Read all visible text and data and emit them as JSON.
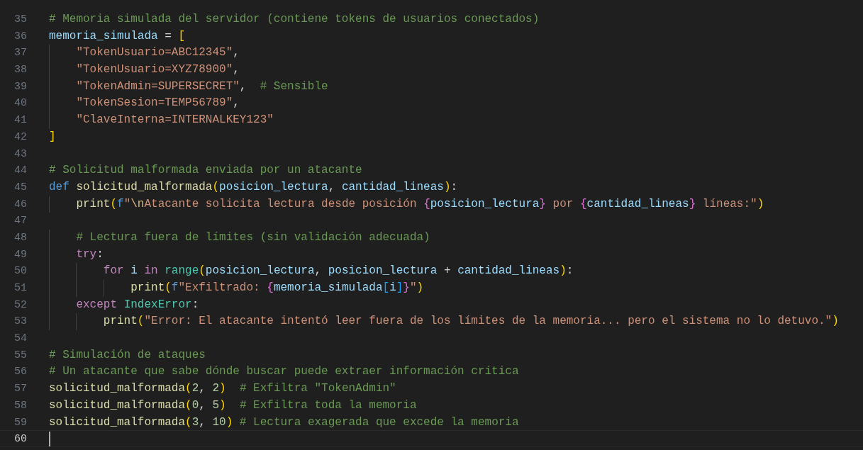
{
  "editor": {
    "lines": [
      {
        "number": "35",
        "current": false,
        "tokens": [
          {
            "kind": "comment",
            "text": "# Memoria simulada del servidor (contiene tokens de usuarios conectados)"
          }
        ]
      },
      {
        "number": "36",
        "current": false,
        "tokens": [
          {
            "kind": "variable",
            "text": "memoria_simulada"
          },
          {
            "kind": "plain",
            "text": " = "
          },
          {
            "kind": "bracket1",
            "text": "["
          }
        ]
      },
      {
        "number": "37",
        "current": false,
        "tokens": [
          {
            "kind": "string",
            "text": "    \"TokenUsuario=ABC12345\""
          },
          {
            "kind": "plain",
            "text": ","
          }
        ]
      },
      {
        "number": "38",
        "current": false,
        "tokens": [
          {
            "kind": "string",
            "text": "    \"TokenUsuario=XYZ78900\""
          },
          {
            "kind": "plain",
            "text": ","
          }
        ]
      },
      {
        "number": "39",
        "current": false,
        "tokens": [
          {
            "kind": "string",
            "text": "    \"TokenAdmin=SUPERSECRET\""
          },
          {
            "kind": "plain",
            "text": ",  "
          },
          {
            "kind": "comment",
            "text": "# Sensible"
          }
        ]
      },
      {
        "number": "40",
        "current": false,
        "tokens": [
          {
            "kind": "string",
            "text": "    \"TokenSesion=TEMP56789\""
          },
          {
            "kind": "plain",
            "text": ","
          }
        ]
      },
      {
        "number": "41",
        "current": false,
        "tokens": [
          {
            "kind": "string",
            "text": "    \"ClaveInterna=INTERNALKEY123\""
          }
        ]
      },
      {
        "number": "42",
        "current": false,
        "tokens": [
          {
            "kind": "bracket1",
            "text": "]"
          }
        ]
      },
      {
        "number": "43",
        "current": false
      },
      {
        "number": "44",
        "current": false,
        "tokens": [
          {
            "kind": "comment",
            "text": "# Solicitud malformada enviada por un atacante"
          }
        ]
      },
      {
        "number": "45",
        "current": false,
        "tokens": [
          {
            "kind": "keyword",
            "text": "def "
          },
          {
            "kind": "function",
            "text": "solicitud_malformada"
          },
          {
            "kind": "bracket1",
            "text": "("
          },
          {
            "kind": "variable",
            "text": "posicion_lectura"
          },
          {
            "kind": "plain",
            "text": ", "
          },
          {
            "kind": "variable",
            "text": "cantidad_lineas"
          },
          {
            "kind": "bracket1",
            "text": ")"
          },
          {
            "kind": "plain",
            "text": ":"
          }
        ]
      },
      {
        "number": "46",
        "current": false,
        "tokens": [
          {
            "kind": "function",
            "text": "    print"
          },
          {
            "kind": "bracket1",
            "text": "("
          },
          {
            "kind": "keyword",
            "text": "f"
          },
          {
            "kind": "string",
            "text": "\""
          },
          {
            "kind": "escape",
            "text": "\\n"
          },
          {
            "kind": "string",
            "text": "Atacante solicita lectura desde posición "
          },
          {
            "kind": "bracket2",
            "text": "{"
          },
          {
            "kind": "variable",
            "text": "posicion_lectura"
          },
          {
            "kind": "bracket2",
            "text": "}"
          },
          {
            "kind": "string",
            "text": " por "
          },
          {
            "kind": "bracket2",
            "text": "{"
          },
          {
            "kind": "variable",
            "text": "cantidad_lineas"
          },
          {
            "kind": "bracket2",
            "text": "}"
          },
          {
            "kind": "string",
            "text": " líneas:\""
          },
          {
            "kind": "bracket1",
            "text": ")"
          }
        ]
      },
      {
        "number": "47",
        "current": false
      },
      {
        "number": "48",
        "current": false,
        "tokens": [
          {
            "kind": "comment",
            "text": "    # Lectura fuera de límites (sin validación adecuada)"
          }
        ]
      },
      {
        "number": "49",
        "current": false,
        "tokens": [
          {
            "kind": "control",
            "text": "    try"
          },
          {
            "kind": "plain",
            "text": ":"
          }
        ]
      },
      {
        "number": "50",
        "current": false,
        "tokens": [
          {
            "kind": "control",
            "text": "        for "
          },
          {
            "kind": "variable",
            "text": "i "
          },
          {
            "kind": "control",
            "text": "in "
          },
          {
            "kind": "type",
            "text": "range"
          },
          {
            "kind": "bracket1",
            "text": "("
          },
          {
            "kind": "variable",
            "text": "posicion_lectura"
          },
          {
            "kind": "plain",
            "text": ", "
          },
          {
            "kind": "variable",
            "text": "posicion_lectura"
          },
          {
            "kind": "plain",
            "text": " + "
          },
          {
            "kind": "variable",
            "text": "cantidad_lineas"
          },
          {
            "kind": "bracket1",
            "text": ")"
          },
          {
            "kind": "plain",
            "text": ":"
          }
        ]
      },
      {
        "number": "51",
        "current": false,
        "tokens": [
          {
            "kind": "function",
            "text": "            print"
          },
          {
            "kind": "bracket1",
            "text": "("
          },
          {
            "kind": "keyword",
            "text": "f"
          },
          {
            "kind": "string",
            "text": "\"Exfiltrado: "
          },
          {
            "kind": "bracket2",
            "text": "{"
          },
          {
            "kind": "variable",
            "text": "memoria_simulada"
          },
          {
            "kind": "bracket3",
            "text": "["
          },
          {
            "kind": "variable",
            "text": "i"
          },
          {
            "kind": "bracket3",
            "text": "]"
          },
          {
            "kind": "bracket2",
            "text": "}"
          },
          {
            "kind": "string",
            "text": "\""
          },
          {
            "kind": "bracket1",
            "text": ")"
          }
        ]
      },
      {
        "number": "52",
        "current": false,
        "tokens": [
          {
            "kind": "control",
            "text": "    except "
          },
          {
            "kind": "type",
            "text": "IndexError"
          },
          {
            "kind": "plain",
            "text": ":"
          }
        ]
      },
      {
        "number": "53",
        "current": false,
        "tokens": [
          {
            "kind": "function",
            "text": "        print"
          },
          {
            "kind": "bracket1",
            "text": "("
          },
          {
            "kind": "string",
            "text": "\"Error: El atacante intentó leer fuera de los límites de la memoria... pero el sistema no lo detuvo.\""
          },
          {
            "kind": "bracket1",
            "text": ")"
          }
        ]
      },
      {
        "number": "54",
        "current": false
      },
      {
        "number": "55",
        "current": false,
        "tokens": [
          {
            "kind": "comment",
            "text": "# Simulación de ataques"
          }
        ]
      },
      {
        "number": "56",
        "current": false,
        "tokens": [
          {
            "kind": "comment",
            "text": "# Un atacante que sabe dónde buscar puede extraer información crítica"
          }
        ]
      },
      {
        "number": "57",
        "current": false,
        "tokens": [
          {
            "kind": "function",
            "text": "solicitud_malformada"
          },
          {
            "kind": "bracket1",
            "text": "("
          },
          {
            "kind": "number",
            "text": "2"
          },
          {
            "kind": "plain",
            "text": ", "
          },
          {
            "kind": "number",
            "text": "2"
          },
          {
            "kind": "bracket1",
            "text": ")"
          },
          {
            "kind": "comment",
            "text": "  # Exfiltra \"TokenAdmin\""
          }
        ]
      },
      {
        "number": "58",
        "current": false,
        "tokens": [
          {
            "kind": "function",
            "text": "solicitud_malformada"
          },
          {
            "kind": "bracket1",
            "text": "("
          },
          {
            "kind": "number",
            "text": "0"
          },
          {
            "kind": "plain",
            "text": ", "
          },
          {
            "kind": "number",
            "text": "5"
          },
          {
            "kind": "bracket1",
            "text": ")"
          },
          {
            "kind": "comment",
            "text": "  # Exfiltra toda la memoria"
          }
        ]
      },
      {
        "number": "59",
        "current": false,
        "tokens": [
          {
            "kind": "function",
            "text": "solicitud_malformada"
          },
          {
            "kind": "bracket1",
            "text": "("
          },
          {
            "kind": "number",
            "text": "3"
          },
          {
            "kind": "plain",
            "text": ", "
          },
          {
            "kind": "number",
            "text": "10"
          },
          {
            "kind": "bracket1",
            "text": ")"
          },
          {
            "kind": "comment",
            "text": " # Lectura exagerada que excede la memoria"
          }
        ]
      },
      {
        "number": "60",
        "current": true
      }
    ]
  }
}
